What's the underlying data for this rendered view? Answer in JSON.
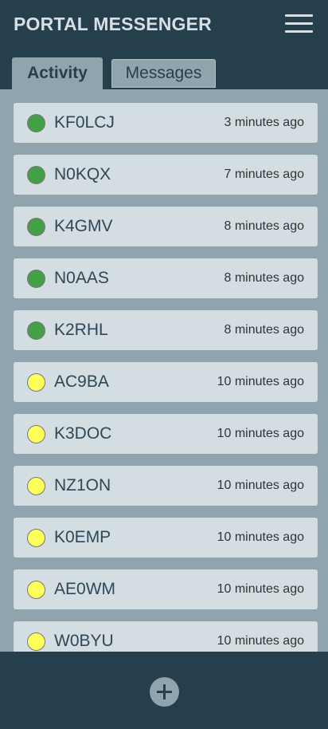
{
  "app": {
    "title": "PORTAL MESSENGER"
  },
  "header": {
    "menu_icon": "hamburger-menu-icon"
  },
  "tabs": [
    {
      "label": "Activity",
      "active": true
    },
    {
      "label": "Messages",
      "active": false
    }
  ],
  "colors": {
    "online": "#43a047",
    "idle": "#ffff5a",
    "header": "#263f4d",
    "background": "#90a4ae"
  },
  "activity": [
    {
      "callsign": "KF0LCJ",
      "time": "3 minutes ago",
      "status": "online"
    },
    {
      "callsign": "N0KQX",
      "time": "7 minutes ago",
      "status": "online"
    },
    {
      "callsign": "K4GMV",
      "time": "8 minutes ago",
      "status": "online"
    },
    {
      "callsign": "N0AAS",
      "time": "8 minutes ago",
      "status": "online"
    },
    {
      "callsign": "K2RHL",
      "time": "8 minutes ago",
      "status": "online"
    },
    {
      "callsign": "AC9BA",
      "time": "10 minutes ago",
      "status": "idle"
    },
    {
      "callsign": "K3DOC",
      "time": "10 minutes ago",
      "status": "idle"
    },
    {
      "callsign": "NZ1ON",
      "time": "10 minutes ago",
      "status": "idle"
    },
    {
      "callsign": "K0EMP",
      "time": "10 minutes ago",
      "status": "idle"
    },
    {
      "callsign": "AE0WM",
      "time": "10 minutes ago",
      "status": "idle"
    },
    {
      "callsign": "W0BYU",
      "time": "10 minutes ago",
      "status": "idle"
    }
  ],
  "footer": {
    "add_icon": "plus-icon"
  }
}
